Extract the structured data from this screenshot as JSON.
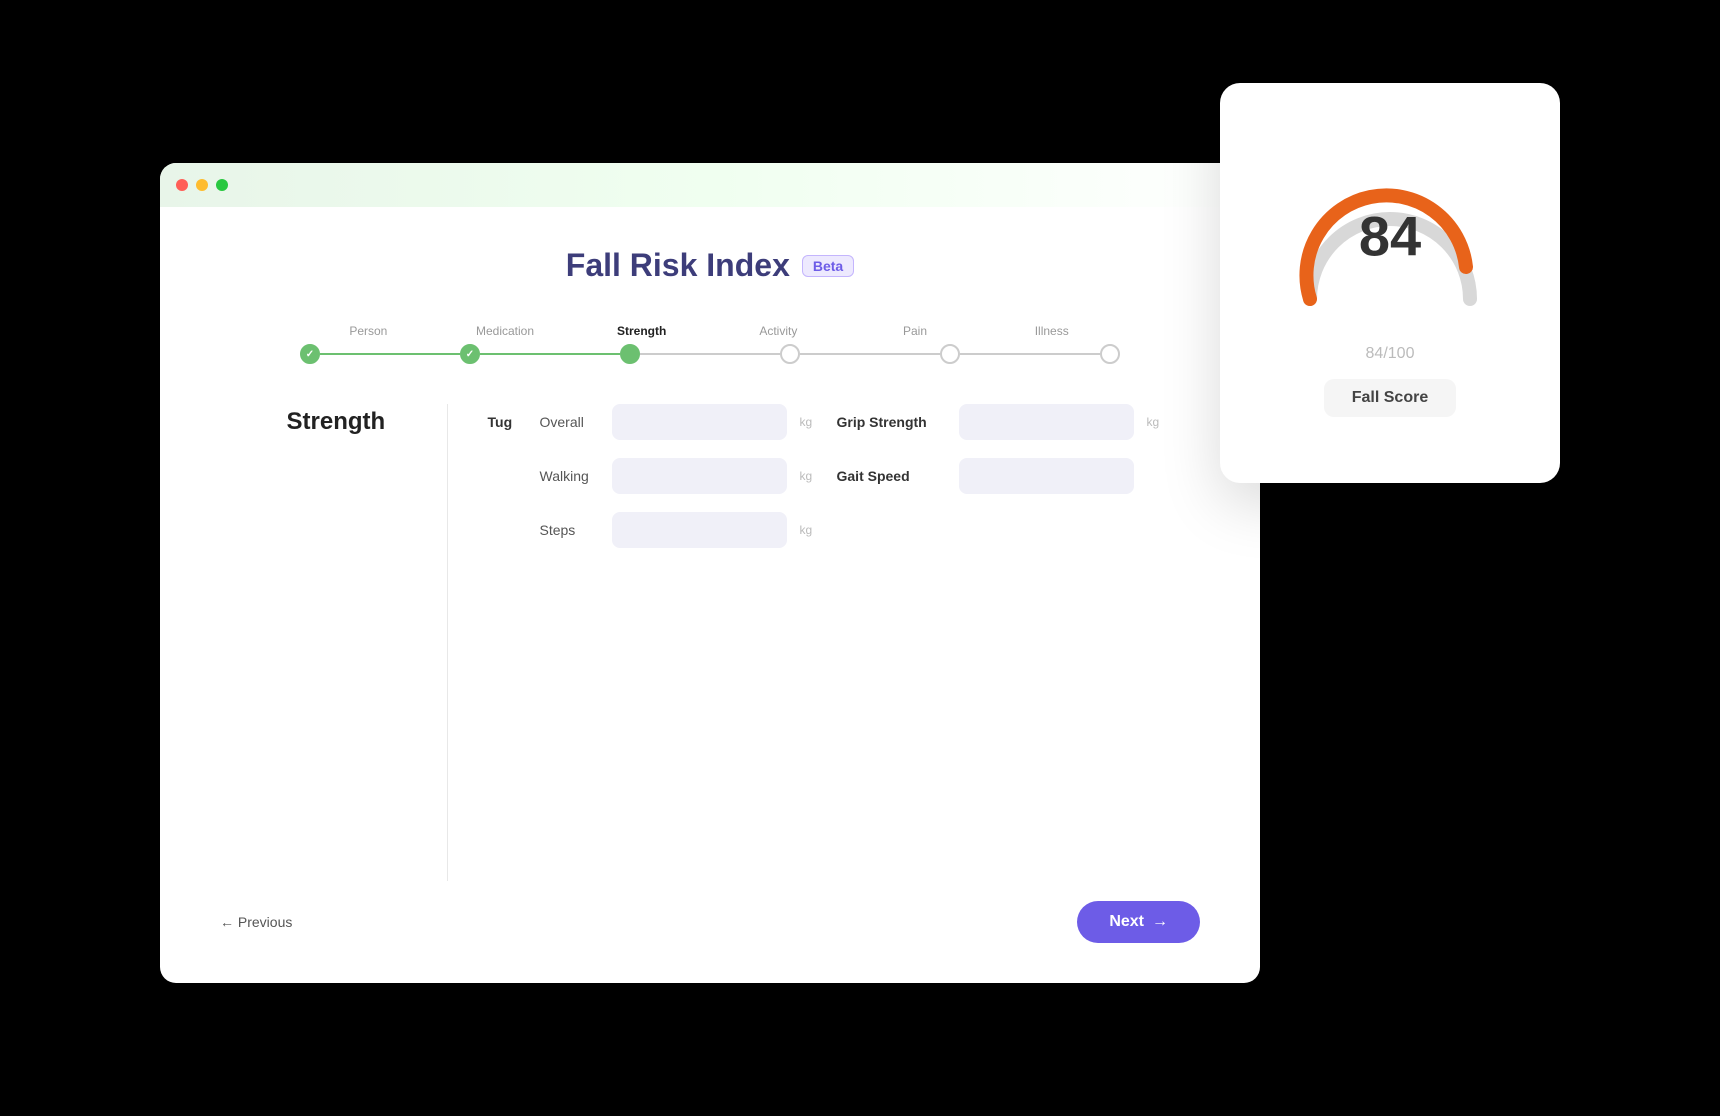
{
  "title": "Fall Risk Index",
  "badge": "Beta",
  "steps": [
    {
      "id": "person",
      "label": "Person",
      "state": "completed"
    },
    {
      "id": "medication",
      "label": "Medication",
      "state": "completed"
    },
    {
      "id": "strength",
      "label": "Strength",
      "state": "current"
    },
    {
      "id": "activity",
      "label": "Activity",
      "state": "inactive"
    },
    {
      "id": "pain",
      "label": "Pain",
      "state": "inactive"
    },
    {
      "id": "illness",
      "label": "Illness",
      "state": "inactive"
    }
  ],
  "section": {
    "title": "Strength",
    "tug_label": "Tug",
    "fields_left": [
      {
        "label": "Overall",
        "unit": "kg",
        "value": ""
      },
      {
        "label": "Walking",
        "unit": "kg",
        "value": ""
      },
      {
        "label": "Steps",
        "unit": "kg",
        "value": ""
      }
    ],
    "fields_right": [
      {
        "label": "Grip Strength",
        "unit": "kg",
        "value": ""
      },
      {
        "label": "Gait Speed",
        "unit": "",
        "value": ""
      }
    ]
  },
  "nav": {
    "prev_label": "← Previous",
    "next_label": "Next →"
  },
  "score_card": {
    "score": "84",
    "fraction": "84/100",
    "button_label": "Fall Score"
  },
  "gauge": {
    "arc_color_active": "#e8631a",
    "arc_color_inactive": "#d0d0d0",
    "score_value": 84,
    "max_value": 100
  }
}
